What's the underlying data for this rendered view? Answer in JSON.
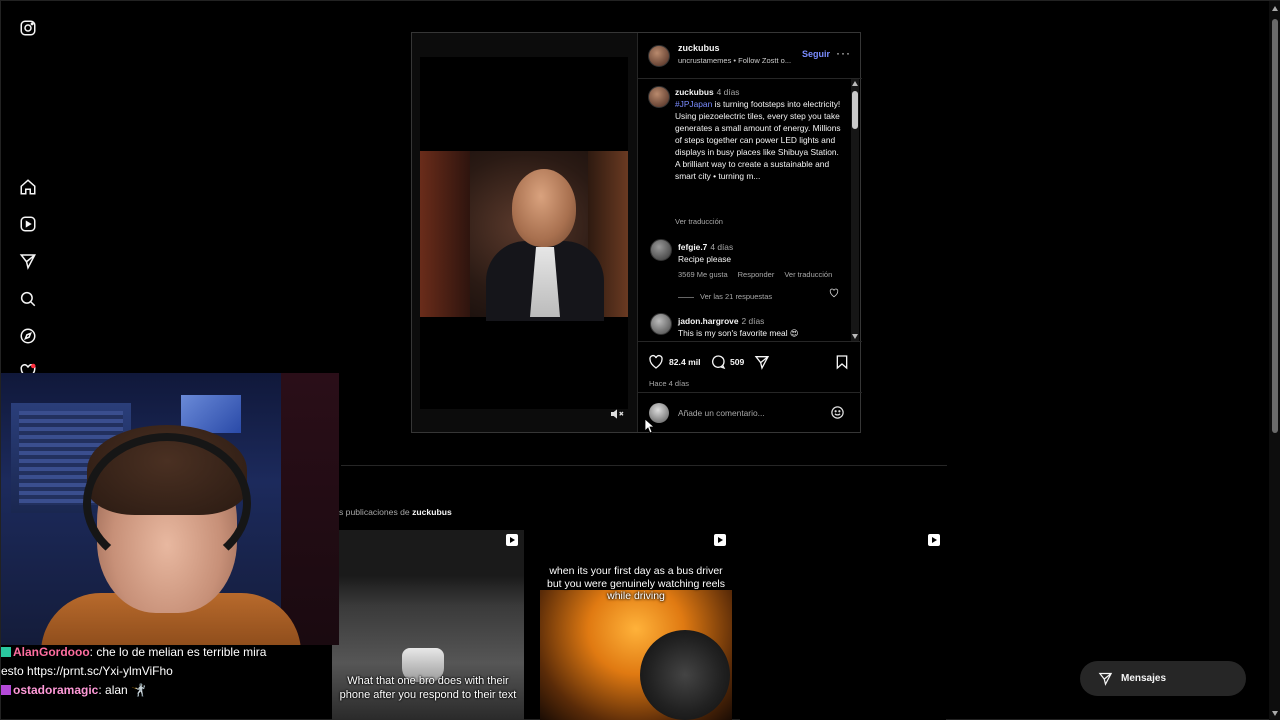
{
  "nav": {
    "icons": [
      "instagram-logo-icon",
      "home-icon",
      "reels-icon",
      "direct-icon",
      "search-icon",
      "explore-icon",
      "notifications-icon"
    ]
  },
  "post": {
    "header": {
      "username": "zuckubus",
      "subtitle": "uncrustamemes • Follow Zostt o...",
      "follow_label": "Seguir",
      "more_label": "···"
    },
    "caption": {
      "username": "zuckubus",
      "time": "4 días",
      "hashtag": "#JPJapan",
      "text_1": " is turning footsteps into electricity!",
      "text_2": "Using piezoelectric tiles, every step you take generates a small amount of energy. Millions of steps together can power LED lights and displays in busy places like Shibuya Station. A brilliant way to create a sustainable and smart city • turning m...",
      "translate_label": "Ver traducción"
    },
    "comments": [
      {
        "username": "fefgie.7",
        "time": "4 días",
        "text": "Recipe please",
        "likes_label": "3569 Me gusta",
        "reply_label": "Responder",
        "translate_label": "Ver traducción",
        "replies_label": "Ver las 21 respuestas"
      },
      {
        "username": "jadon.hargrove",
        "time": "2 días",
        "text": "This is my son's favorite meal 😍"
      }
    ],
    "actions": {
      "likes": "82.4 mil",
      "comments": "509",
      "posted": "Hace 4 días"
    },
    "add_comment_placeholder": "Añade un comentario..."
  },
  "more_posts": {
    "prefix": "s publicaciones de ",
    "username": "zuckubus",
    "thumbs": [
      {
        "caption": "What that one bro does with their phone after you respond to their text"
      },
      {
        "caption_1": "when its your first day as a bus driver",
        "caption_2": "but you were genuinely watching reels while driving"
      },
      {}
    ]
  },
  "chat": [
    {
      "name": "AlanGordooo",
      "text": ": che lo de melian es terrible mira"
    },
    {
      "text": "esto https://prnt.sc/Yxi-ylmViFho"
    },
    {
      "name": "ostadoramagic",
      "text": ": alan 🤺"
    }
  ],
  "messages_label": "Mensajes",
  "colors": {
    "accent": "#7a8cff",
    "background": "#000000",
    "muted": "#a8a8a8"
  }
}
